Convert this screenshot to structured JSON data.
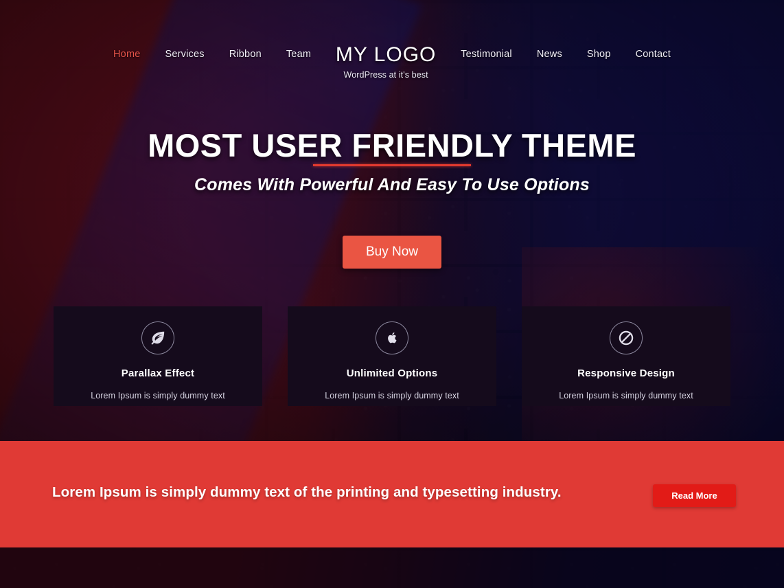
{
  "header": {
    "nav_left": [
      {
        "label": "Home",
        "active": true
      },
      {
        "label": "Services",
        "active": false
      },
      {
        "label": "Ribbon",
        "active": false
      },
      {
        "label": "Team",
        "active": false
      }
    ],
    "logo": {
      "title": "MY LOGO",
      "tagline": "WordPress at it's best"
    },
    "nav_right": [
      {
        "label": "Testimonial",
        "active": false
      },
      {
        "label": "News",
        "active": false
      },
      {
        "label": "Shop",
        "active": false
      },
      {
        "label": "Contact",
        "active": false
      }
    ]
  },
  "hero": {
    "title": "MOST USER FRIENDLY THEME",
    "subtitle": "Comes With Powerful And Easy To Use Options",
    "button_label": "Buy Now"
  },
  "features": [
    {
      "icon": "leaf-icon",
      "title": "Parallax Effect",
      "description": "Lorem Ipsum is simply dummy text"
    },
    {
      "icon": "apple-icon",
      "title": "Unlimited Options",
      "description": "Lorem Ipsum is simply dummy text"
    },
    {
      "icon": "ban-icon",
      "title": "Responsive Design",
      "description": "Lorem Ipsum is simply dummy text"
    }
  ],
  "cta": {
    "text": "Lorem Ipsum is simply dummy text of the printing and typesetting industry.",
    "button_label": "Read More"
  },
  "colors": {
    "accent_red": "#e8544a",
    "button_red": "#ea5543",
    "cta_band_red": "#e03a35",
    "cta_button_red": "#e21b17",
    "rule_red": "#e0392f",
    "card_bg": "#150b1c",
    "text_white": "#ffffff"
  }
}
